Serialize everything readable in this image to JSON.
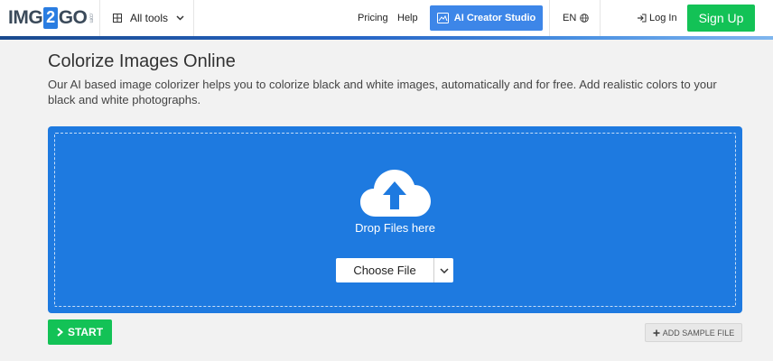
{
  "header": {
    "logo": {
      "left": "IMG",
      "mid": "2",
      "right": "GO",
      "suffix": ".com"
    },
    "all_tools": "All tools",
    "nav": {
      "pricing": "Pricing",
      "help": "Help"
    },
    "ai_creator": "AI Creator Studio",
    "language": "EN",
    "login": "Log In",
    "signup": "Sign Up"
  },
  "main": {
    "title": "Colorize Images Online",
    "description": "Our AI based image colorizer helps you to colorize black and white images, automatically and for free. Add realistic colors to your black and white photographs.",
    "dropzone": {
      "drop_text": "Drop Files here",
      "choose_file": "Choose File"
    },
    "start": "START",
    "add_sample": "ADD SAMPLE FILE"
  },
  "colors": {
    "brand_blue": "#1e7ae0",
    "ai_button": "#3d86e8",
    "green": "#13c256"
  },
  "icons": [
    "grid-icon",
    "chevron-down-icon",
    "ai-icon",
    "globe-icon",
    "login-icon",
    "cloud-upload-icon",
    "chevron-right-icon",
    "plus-icon"
  ]
}
